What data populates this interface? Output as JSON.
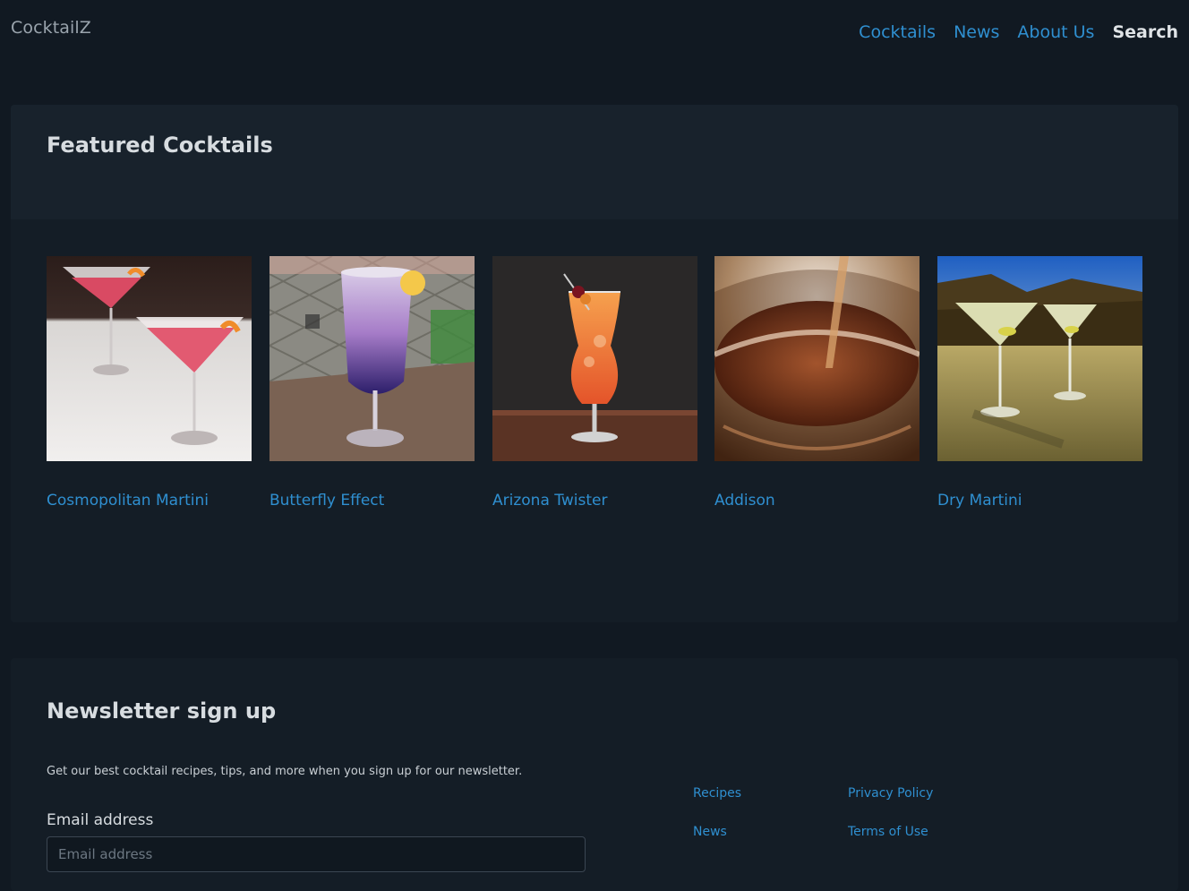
{
  "brand": "CocktailZ",
  "nav": {
    "items": [
      "Cocktails",
      "News",
      "About Us"
    ],
    "active": "Search"
  },
  "featured": {
    "title": "Featured Cocktails",
    "items": [
      {
        "name": "Cosmopolitan Martini",
        "image": "cosmopolitan-photo"
      },
      {
        "name": "Butterfly Effect",
        "image": "butterfly-effect-photo"
      },
      {
        "name": "Arizona Twister",
        "image": "arizona-twister-photo"
      },
      {
        "name": "Addison",
        "image": "addison-photo"
      },
      {
        "name": "Dry Martini",
        "image": "dry-martini-photo"
      }
    ]
  },
  "newsletter": {
    "title": "Newsletter sign up",
    "description": "Get our best cocktail recipes, tips, and more when you sign up for our newsletter.",
    "email_label": "Email address",
    "email_placeholder": "Email address"
  },
  "footer": {
    "col1": [
      "Recipes",
      "News"
    ],
    "col2": [
      "Privacy Policy",
      "Terms of Use"
    ]
  },
  "colors": {
    "background": "#111922",
    "card": "#141d26",
    "card_header": "#18222c",
    "link": "#2f8fd0",
    "heading": "#d7dce0"
  }
}
